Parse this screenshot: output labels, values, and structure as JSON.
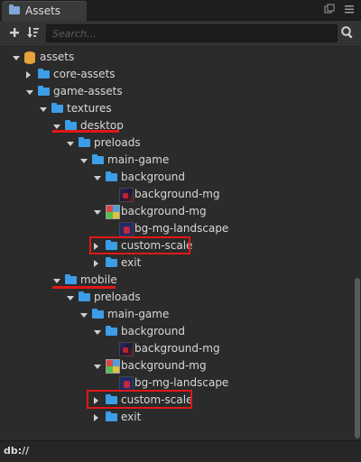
{
  "tab": {
    "title": "Assets"
  },
  "toolbar": {
    "search_placeholder": "Search..."
  },
  "footer": {
    "path": "db://"
  },
  "tree": [
    {
      "label": "assets",
      "kind": "db",
      "arrow": "down"
    },
    {
      "label": "core-assets",
      "kind": "folder",
      "arrow": "right"
    },
    {
      "label": "game-assets",
      "kind": "folder",
      "arrow": "down"
    },
    {
      "label": "textures",
      "kind": "folder",
      "arrow": "down"
    },
    {
      "label": "desktop",
      "kind": "folder",
      "arrow": "down"
    },
    {
      "label": "preloads",
      "kind": "folder",
      "arrow": "down"
    },
    {
      "label": "main-game",
      "kind": "folder",
      "arrow": "down"
    },
    {
      "label": "background",
      "kind": "folder",
      "arrow": "down"
    },
    {
      "label": "background-mg",
      "kind": "image",
      "arrow": "none"
    },
    {
      "label": "background-mg",
      "kind": "atlas",
      "arrow": "down"
    },
    {
      "label": "bg-mg-landscape",
      "kind": "sprite",
      "arrow": "none"
    },
    {
      "label": "custom-scale",
      "kind": "folder",
      "arrow": "right"
    },
    {
      "label": "exit",
      "kind": "folder",
      "arrow": "right"
    },
    {
      "label": "mobile",
      "kind": "folder",
      "arrow": "down"
    },
    {
      "label": "preloads",
      "kind": "folder",
      "arrow": "down"
    },
    {
      "label": "main-game",
      "kind": "folder",
      "arrow": "down"
    },
    {
      "label": "background",
      "kind": "folder",
      "arrow": "down"
    },
    {
      "label": "background-mg",
      "kind": "image",
      "arrow": "none"
    },
    {
      "label": "background-mg",
      "kind": "atlas",
      "arrow": "down"
    },
    {
      "label": "bg-mg-landscape",
      "kind": "sprite",
      "arrow": "none"
    },
    {
      "label": "custom-scale",
      "kind": "folder",
      "arrow": "right"
    },
    {
      "label": "exit",
      "kind": "folder",
      "arrow": "right"
    }
  ],
  "colors": {
    "folder": "#3b9ee8",
    "highlight": "#e01818",
    "background": "#2b2b2b"
  }
}
